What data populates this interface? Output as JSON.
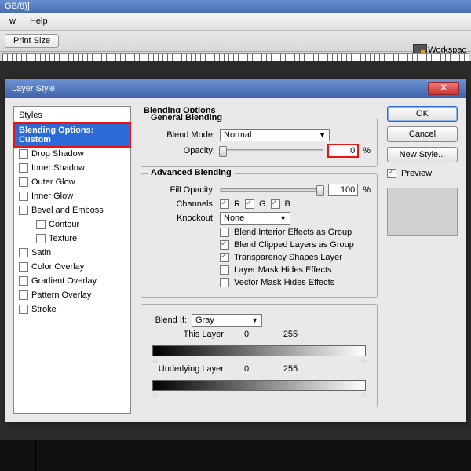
{
  "titlebar": {
    "fragment": "GB/8)]"
  },
  "menubar": {
    "items": [
      "w",
      "Help"
    ]
  },
  "toolbar": {
    "printSize": "Print Size"
  },
  "workspace": {
    "label": "Workspac"
  },
  "dialog": {
    "title": "Layer Style",
    "stylesHeader": "Styles",
    "styles": [
      {
        "label": "Blending Options: Custom",
        "selected": true,
        "checkbox": false
      },
      {
        "label": "Drop Shadow",
        "checkbox": true,
        "checked": false
      },
      {
        "label": "Inner Shadow",
        "checkbox": true,
        "checked": false
      },
      {
        "label": "Outer Glow",
        "checkbox": true,
        "checked": false
      },
      {
        "label": "Inner Glow",
        "checkbox": true,
        "checked": false
      },
      {
        "label": "Bevel and Emboss",
        "checkbox": true,
        "checked": false
      },
      {
        "label": "Contour",
        "checkbox": true,
        "checked": false,
        "indent": true
      },
      {
        "label": "Texture",
        "checkbox": true,
        "checked": false,
        "indent": true
      },
      {
        "label": "Satin",
        "checkbox": true,
        "checked": false
      },
      {
        "label": "Color Overlay",
        "checkbox": true,
        "checked": false
      },
      {
        "label": "Gradient Overlay",
        "checkbox": true,
        "checked": false
      },
      {
        "label": "Pattern Overlay",
        "checkbox": true,
        "checked": false
      },
      {
        "label": "Stroke",
        "checkbox": true,
        "checked": false
      }
    ],
    "optionsHeader": "Blending Options",
    "general": {
      "title": "General Blending",
      "blendModeLabel": "Blend Mode:",
      "blendMode": "Normal",
      "opacityLabel": "Opacity:",
      "opacity": "0",
      "pct": "%"
    },
    "advanced": {
      "title": "Advanced Blending",
      "fillOpacityLabel": "Fill Opacity:",
      "fillOpacity": "100",
      "pct": "%",
      "channelsLabel": "Channels:",
      "ch": {
        "r": "R",
        "g": "G",
        "b": "B"
      },
      "knockoutLabel": "Knockout:",
      "knockout": "None",
      "opts": {
        "interior": "Blend Interior Effects as Group",
        "clipped": "Blend Clipped Layers as Group",
        "transparency": "Transparency Shapes Layer",
        "layerMask": "Layer Mask Hides Effects",
        "vectorMask": "Vector Mask Hides Effects"
      }
    },
    "blendIf": {
      "title": "Blend If:",
      "channel": "Gray",
      "thisLayerLabel": "This Layer:",
      "underlyingLabel": "Underlying Layer:",
      "v0": "0",
      "v255": "255"
    },
    "buttons": {
      "ok": "OK",
      "cancel": "Cancel",
      "newStyle": "New Style..."
    },
    "previewLabel": "Preview"
  }
}
